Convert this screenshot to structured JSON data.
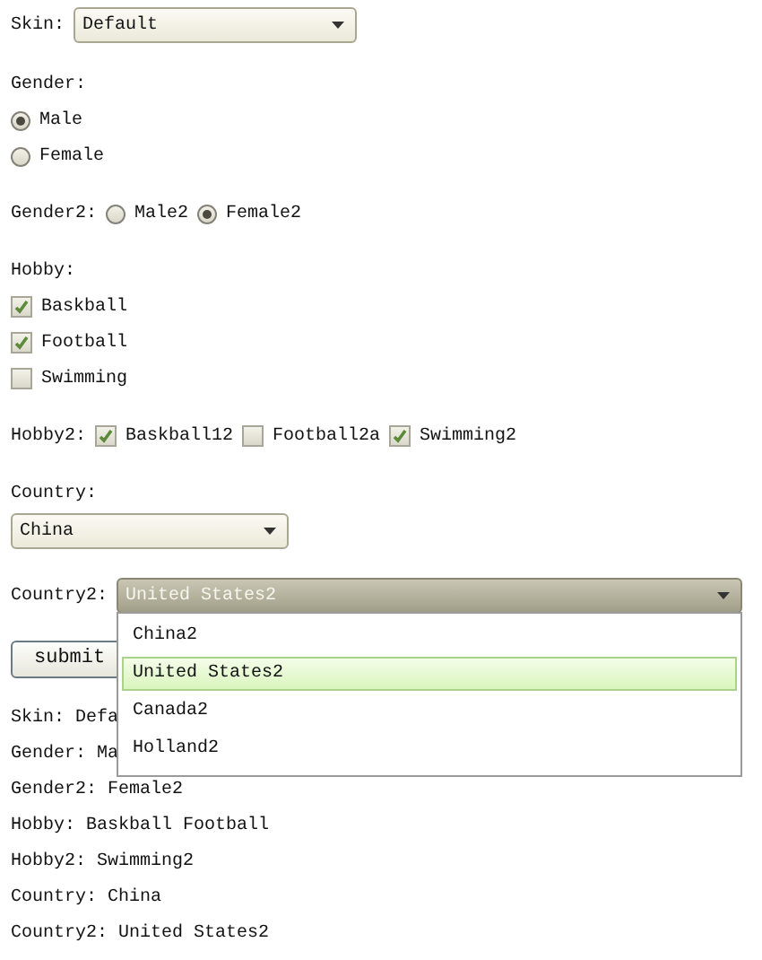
{
  "skin": {
    "label": "Skin:",
    "value": "Default"
  },
  "gender": {
    "label": "Gender:",
    "options": [
      {
        "label": "Male",
        "selected": true
      },
      {
        "label": "Female",
        "selected": false
      }
    ]
  },
  "gender2": {
    "label": "Gender2:",
    "options": [
      {
        "label": "Male2",
        "selected": false
      },
      {
        "label": "Female2",
        "selected": true
      }
    ]
  },
  "hobby": {
    "label": "Hobby:",
    "options": [
      {
        "label": "Baskball",
        "checked": true
      },
      {
        "label": "Football",
        "checked": true
      },
      {
        "label": "Swimming",
        "checked": false
      }
    ]
  },
  "hobby2": {
    "label": "Hobby2:",
    "options": [
      {
        "label": "Baskball12",
        "checked": true
      },
      {
        "label": "Football2a",
        "checked": false
      },
      {
        "label": "Swimming2",
        "checked": true
      }
    ]
  },
  "country": {
    "label": "Country:",
    "value": "China"
  },
  "country2": {
    "label": "Country2:",
    "value": "United States2",
    "expanded": true,
    "options": [
      {
        "label": "China2",
        "selected": false
      },
      {
        "label": "United States2",
        "selected": true
      },
      {
        "label": "Canada2",
        "selected": false
      },
      {
        "label": "Holland2",
        "selected": false
      }
    ]
  },
  "submit": "submit",
  "output": [
    "Skin: Defa",
    "Gender: Ma",
    "Gender2: Female2",
    "Hobby: Baskball Football",
    "Hobby2: Swimming2",
    "Country: China",
    "Country2: United States2"
  ]
}
